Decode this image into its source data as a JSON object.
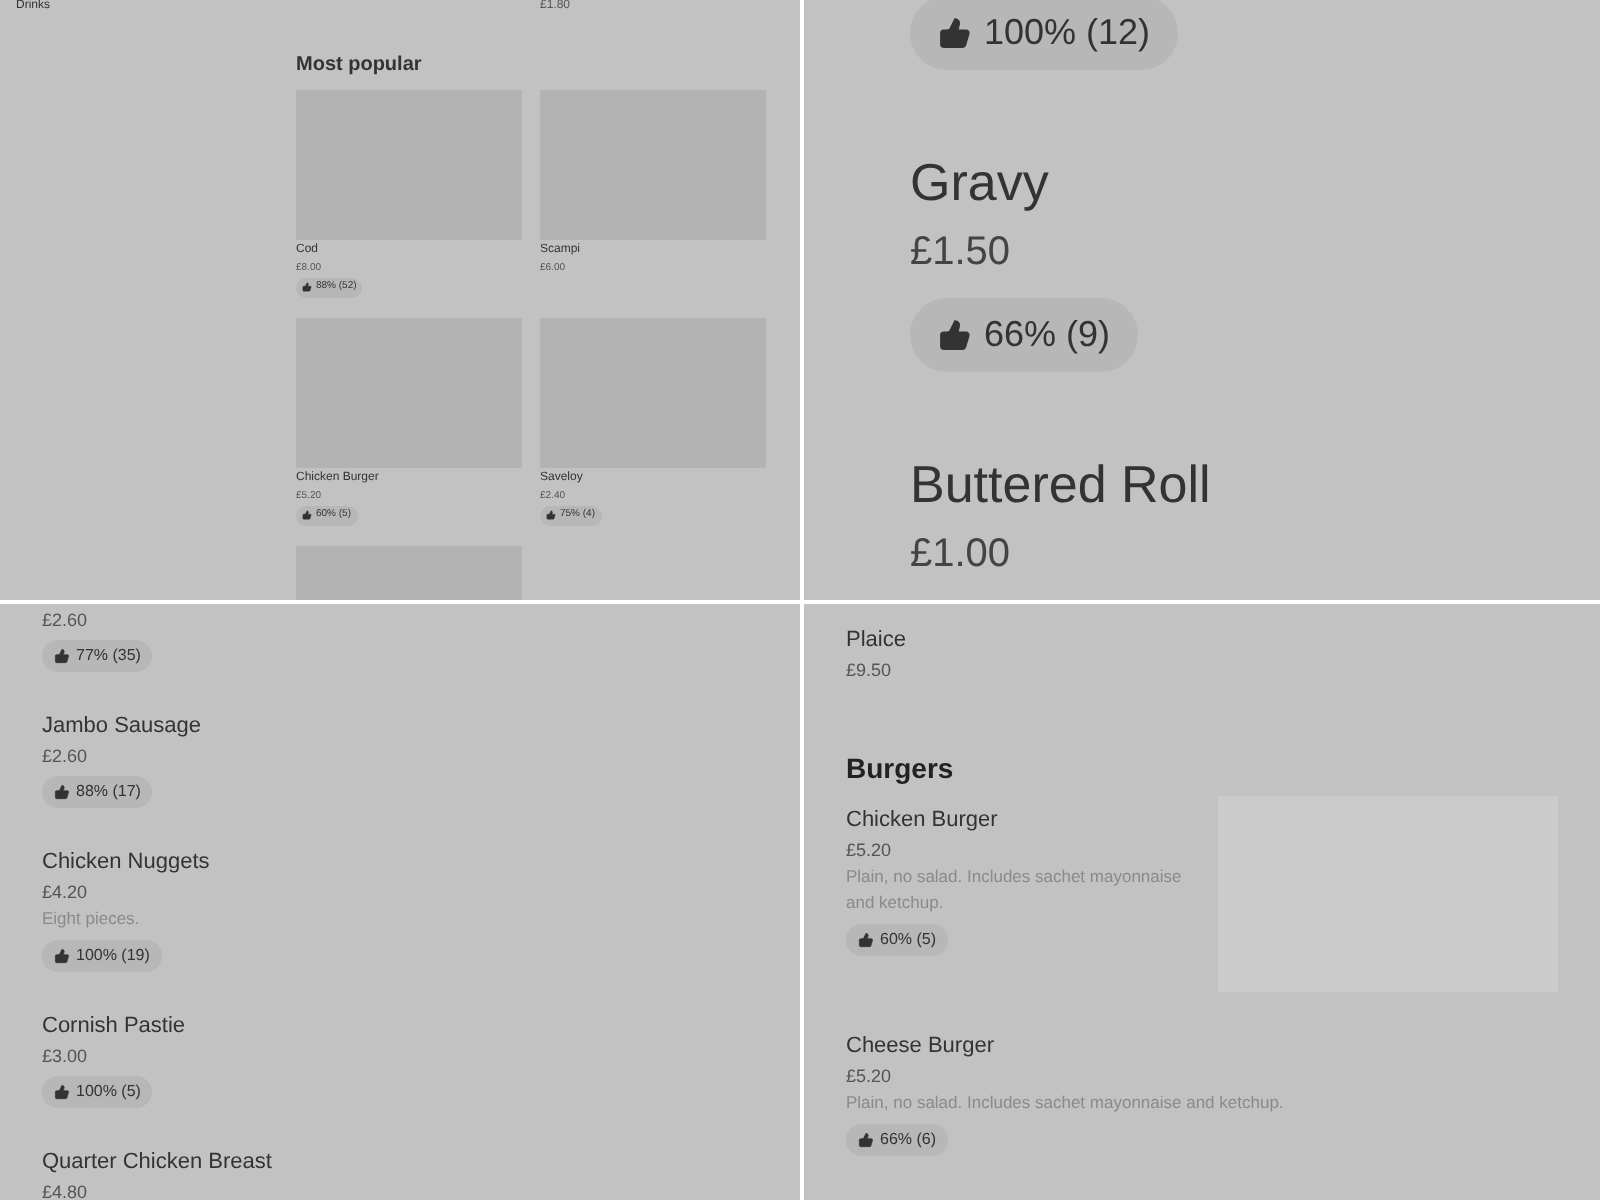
{
  "panels": [
    {
      "kind": "grid",
      "sidebar_link": "Drinks",
      "top_price": "£1.80",
      "heading": "Most popular",
      "cards": [
        {
          "kind": "full",
          "name": "Cod",
          "price": "£8.00",
          "rating": "88% (52)"
        },
        {
          "kind": "full",
          "name": "Scampi",
          "price": "£6.00"
        },
        {
          "kind": "full",
          "name": "Chicken Burger",
          "price": "£5.20",
          "rating": "60% (5)"
        },
        {
          "kind": "full",
          "name": "Saveloy",
          "price": "£2.40",
          "rating": "75% (4)"
        },
        {
          "kind": "image"
        }
      ]
    },
    {
      "kind": "zoomed",
      "items": [
        {
          "kind": "badge",
          "rating": "100% (12)"
        },
        {
          "kind": "dish",
          "name": "Gravy",
          "price": "£1.50",
          "rating": "66% (9)"
        },
        {
          "kind": "dish",
          "name": "Buttered Roll",
          "price": "£1.00"
        }
      ]
    },
    {
      "kind": "list",
      "items": [
        {
          "kind": "dish",
          "price": "£2.60",
          "rating": "77% (35)"
        },
        {
          "kind": "dish",
          "name": "Jambo Sausage",
          "price": "£2.60",
          "rating": "88% (17)"
        },
        {
          "kind": "dish",
          "name": "Chicken Nuggets",
          "price": "£4.20",
          "description": "Eight pieces.",
          "rating": "100% (19)"
        },
        {
          "kind": "dish",
          "name": "Cornish Pastie",
          "price": "£3.00",
          "rating": "100% (5)"
        },
        {
          "kind": "dish",
          "name": "Quarter Chicken Breast",
          "price": "£4.80"
        }
      ]
    },
    {
      "kind": "list",
      "items": [
        {
          "kind": "dish",
          "name": "Plaice",
          "price": "£9.50"
        },
        {
          "kind": "heading",
          "text": "Burgers"
        },
        {
          "kind": "dish",
          "name": "Chicken Burger",
          "price": "£5.20",
          "description": "Plain, no salad. Includes sachet mayonnaise and ketchup.",
          "rating": "60% (5)",
          "image": true
        },
        {
          "kind": "dish",
          "name": "Cheese Burger",
          "price": "£5.20",
          "description": "Plain, no salad. Includes sachet mayonnaise and ketchup.",
          "rating": "66% (6)"
        }
      ]
    }
  ]
}
